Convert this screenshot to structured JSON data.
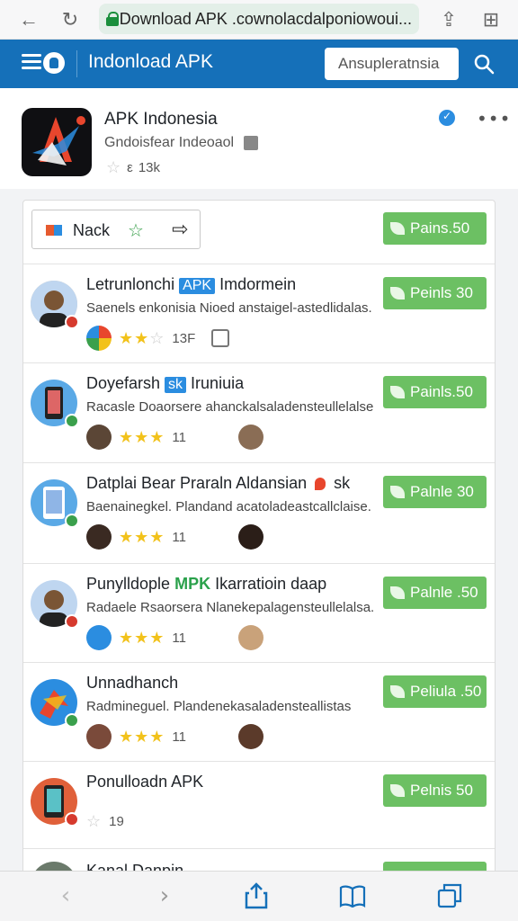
{
  "browser": {
    "url": "Download APK .cownolacdalponiowoui...",
    "back": "←",
    "reload": "↻",
    "share": "⇪",
    "tabs": "⊞"
  },
  "appbar": {
    "title": "Indonload APK",
    "search_placeholder": "Ansupleratnsia"
  },
  "app": {
    "name": "APK Indonesia",
    "subtitle": "Gndoisfear Indeoaol",
    "rating_count": "13k"
  },
  "filter": {
    "label": "Nack"
  },
  "top_button": "Pains.50",
  "items": [
    {
      "title_pre": "Letrunlonchi ",
      "tag": "APK",
      "title_post": " Imdormein",
      "desc": "Saenels enkonisia Nioed anstaigel-astedlidalas.",
      "meta": "13F",
      "stars_on": 2,
      "button": "Peinls 30"
    },
    {
      "title_pre": "Doyefarsh ",
      "tag": "sk",
      "title_post": " Iruniuia",
      "desc": "Racasle Doaorsere ahanckalsaladensteullelalse.",
      "meta": "11",
      "stars_on": 3,
      "button": "Painls.50"
    },
    {
      "title_pre": "Datplai Bear Praraln Aldansian ",
      "tag": "",
      "title_post": " sk",
      "desc": "Baenainegkel. Plandand acatoladeastcallclaise.",
      "meta": "11",
      "stars_on": 3,
      "button": "Palnle 30"
    },
    {
      "title_pre": "Punylldople ",
      "tag": "MPK",
      "title_post": " Ikarratioin daap",
      "desc": "Radaele Rsaorsera Nlanekepalagensteullelalsa.",
      "meta": "11",
      "stars_on": 3,
      "button": "Palnle .50"
    },
    {
      "title_pre": "Unnadhanch",
      "tag": "",
      "title_post": "",
      "desc": "Radmineguel. Plandenekasaladensteallistas",
      "meta": "11",
      "stars_on": 3,
      "button": "Peliula .50"
    },
    {
      "title_pre": "Ponulloadn APK",
      "tag": "",
      "title_post": "",
      "desc": "",
      "meta": "19",
      "stars_on": 0,
      "button": "Pelnis 50"
    },
    {
      "title_pre": "Kanal Danpin",
      "tag": "",
      "title_post": "",
      "desc": "",
      "meta": "",
      "stars_on": 0,
      "button": ""
    }
  ],
  "colors": {
    "appbar": "#1570b9",
    "accent_green": "#6cc063",
    "tag_blue": "#2b8de0"
  },
  "icons": [
    "back-icon",
    "reload-icon",
    "lock-icon",
    "share-icon",
    "add-tab-icon",
    "menu-icon",
    "search-icon",
    "verified-icon",
    "more-icon",
    "star-icon",
    "arrow-icon",
    "bookmarks-icon",
    "tabs-icon",
    "forward-icon"
  ]
}
